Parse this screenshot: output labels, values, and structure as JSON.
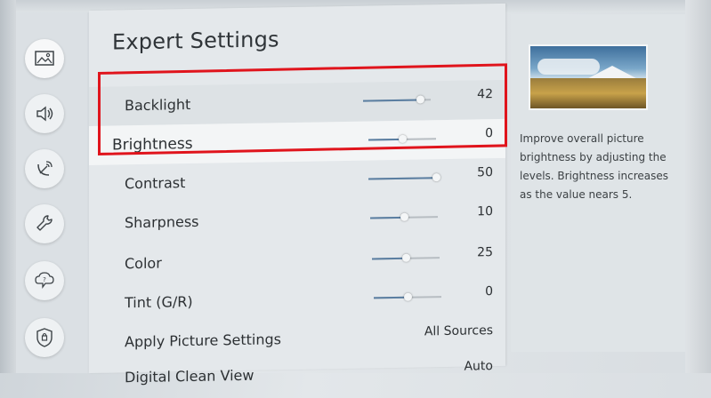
{
  "page": {
    "title": "Expert Settings"
  },
  "nav": {
    "items": [
      {
        "icon": "picture-icon",
        "active": true
      },
      {
        "icon": "sound-icon",
        "active": false
      },
      {
        "icon": "broadcasting-icon",
        "active": false
      },
      {
        "icon": "general-icon",
        "active": false
      },
      {
        "icon": "support-icon",
        "active": false
      },
      {
        "icon": "privacy-icon",
        "active": false
      }
    ]
  },
  "settings": {
    "backlight": {
      "label": "Backlight",
      "value": "42",
      "level": 0.84
    },
    "brightness": {
      "label": "Brightness",
      "value": "0",
      "level": 0.5
    },
    "contrast": {
      "label": "Contrast",
      "value": "50",
      "level": 1.0
    },
    "sharpness": {
      "label": "Sharpness",
      "value": "10",
      "level": 0.5
    },
    "color": {
      "label": "Color",
      "value": "25",
      "level": 0.5
    },
    "tint": {
      "label": "Tint (G/R)",
      "value": "0",
      "level": 0.5
    },
    "apply": {
      "label": "Apply Picture Settings",
      "value": "All Sources"
    },
    "clean_view": {
      "label": "Digital Clean View",
      "value": "Auto"
    }
  },
  "info": {
    "description": "Improve overall picture brightness by adjusting the levels. Brightness increases as the value nears 5."
  },
  "colors": {
    "highlight": "#e0141c",
    "slider_fill": "#5a7ea1"
  }
}
